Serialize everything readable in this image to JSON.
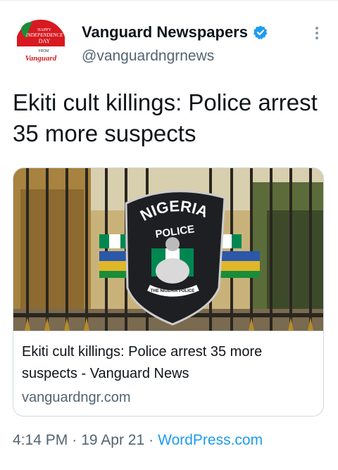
{
  "account": {
    "display_name": "Vanguard Newspapers",
    "handle": "@vanguardngrnews",
    "verified": true,
    "avatar_text": [
      "HAPPY",
      "INDEPENDENCE",
      "DAY",
      "FROM",
      "Vanguard"
    ]
  },
  "tweet": {
    "text": "Ekiti cult killings: Police arrest 35 more suspects"
  },
  "card": {
    "image_text": [
      "NIGERIA",
      "POLICE",
      "THE NIGERIA POLICE"
    ],
    "title": "Ekiti cult killings: Police arrest 35 more suspects - Vanguard News",
    "domain": "vanguardngr.com"
  },
  "meta": {
    "time": "4:14 PM",
    "date": "19 Apr 21",
    "source": "WordPress.com",
    "separator": "·"
  },
  "colors": {
    "link": "#1d9bf0",
    "secondary_text": "#536471",
    "border": "#cfd9de"
  },
  "icons": [
    "verified-badge-icon",
    "more-options-icon"
  ]
}
